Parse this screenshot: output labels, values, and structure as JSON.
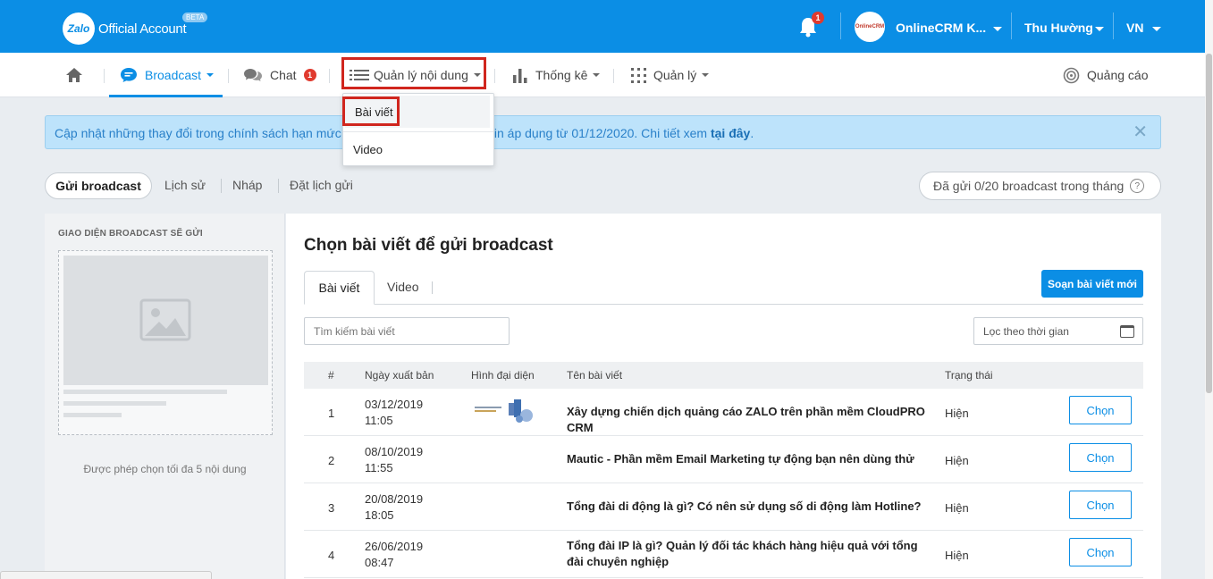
{
  "topbar": {
    "logo_mark": "Zalo",
    "logo_text": "Official Account",
    "beta": "BETA",
    "notification_count": "1",
    "account_avatar_text": "OnlineCRM",
    "account_name": "OnlineCRM K...",
    "user_name": "Thu Hường",
    "language": "VN"
  },
  "nav": {
    "broadcast": "Broadcast",
    "chat": "Chat",
    "chat_badge": "1",
    "content": "Quản lý nội dung",
    "stats": "Thống kê",
    "manage": "Quản lý",
    "ads": "Quảng cáo"
  },
  "dropdown": {
    "items": [
      {
        "label": "Bài viết"
      },
      {
        "label": "Video"
      }
    ]
  },
  "notice": {
    "text_before": "Cập nhật những thay đổi trong chính sách hạn mức",
    "text_after": "tin áp dụng từ 01/12/2020. Chi tiết xem",
    "link": "tại đây",
    "period": "."
  },
  "subtabs": {
    "send": "Gửi broadcast",
    "history": "Lịch sử",
    "draft": "Nháp",
    "schedule": "Đặt lịch gửi",
    "quota": "Đã gửi 0/20 broadcast trong tháng",
    "help": "?"
  },
  "preview": {
    "title": "GIAO DIỆN BROADCAST SẼ GỬI",
    "note": "Được phép chọn tối đa 5 nội dung"
  },
  "main": {
    "title": "Chọn bài viết để gửi broadcast",
    "tab_articles": "Bài viết",
    "tab_video": "Video",
    "compose_button": "Soạn bài viết mới",
    "search_placeholder": "Tìm kiếm bài viết",
    "date_filter": "Lọc theo thời gian"
  },
  "table": {
    "headers": {
      "index": "#",
      "date": "Ngày xuất bản",
      "image": "Hình đại diện",
      "title": "Tên bài viết",
      "status": "Trạng thái"
    },
    "rows": [
      {
        "index": "1",
        "date": "03/12/2019",
        "time": "11:05",
        "title": "Xây dựng chiến dịch quảng cáo ZALO trên phần mềm CloudPRO CRM",
        "status": "Hiện",
        "action": "Chọn"
      },
      {
        "index": "2",
        "date": "08/10/2019",
        "time": "11:55",
        "title": "Mautic - Phần mềm Email Marketing tự động bạn nên dùng thử",
        "status": "Hiện",
        "action": "Chọn"
      },
      {
        "index": "3",
        "date": "20/08/2019",
        "time": "18:05",
        "title": "Tổng đài di động là gì? Có nên sử dụng số di động làm Hotline?",
        "status": "Hiện",
        "action": "Chọn"
      },
      {
        "index": "4",
        "date": "26/06/2019",
        "time": "08:47",
        "title": "Tổng đài IP là gì? Quản lý đối tác khách hàng hiệu quả với tổng đài chuyên nghiệp",
        "status": "Hiện",
        "action": "Chọn"
      }
    ]
  },
  "colors": {
    "brand": "#0b8ee5",
    "highlight": "#d0261e",
    "badge": "#e03a2e"
  }
}
